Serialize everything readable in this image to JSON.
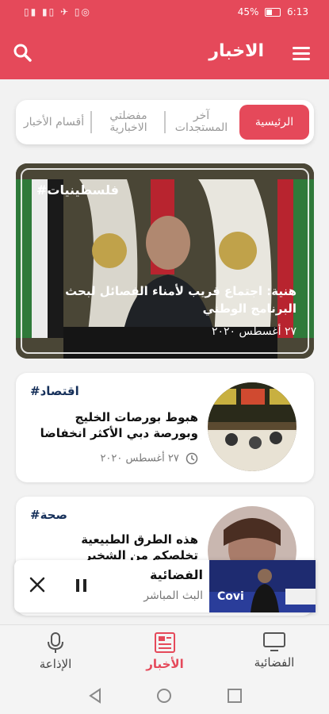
{
  "status_bar": {
    "signals": "▯▮ ▮▯ ✈ ▯◎",
    "battery": "45%",
    "time": "6:13"
  },
  "app_bar": {
    "title": "الاخبار",
    "menu_icon": "hamburger-icon",
    "search_icon": "search-icon"
  },
  "tabs": [
    {
      "label": "الرئيسية",
      "active": true
    },
    {
      "label": "آخر المستجدات",
      "active": false
    },
    {
      "label": "مفضلتي الاخبارية",
      "active": false
    },
    {
      "label": "أقسام الأخبار",
      "active": false
    }
  ],
  "featured": {
    "tag": "#فلسطينيات",
    "headline": "هنية: اجتماع قريب لأمناء الفصائل لبحث البرنامج الوطني",
    "date": "٢٧ أغسطس ٢٠٢٠"
  },
  "articles": [
    {
      "tag": "#اقتصاد",
      "headline": "هبوط بورصات الخليج وبورصة دبي الأكثر انخفاضا",
      "date": "٢٧ أغسطس ٢٠٢٠"
    },
    {
      "tag": "#صحة",
      "headline": "هذه الطرق الطبيعية تخلصكم من الشخير",
      "date": ""
    }
  ],
  "mini_player": {
    "title": "الفضائية",
    "subtitle": "البث المباشر",
    "close_icon": "close-icon",
    "pause_icon": "pause-icon",
    "thumb_text": "Covi"
  },
  "bottom_nav": [
    {
      "label": "الفضائية",
      "icon": "tv-icon",
      "active": false
    },
    {
      "label": "الأخبار",
      "icon": "newspaper-icon",
      "active": true
    },
    {
      "label": "الإذاعة",
      "icon": "microphone-icon",
      "active": false
    }
  ],
  "colors": {
    "accent": "#e5495a",
    "tag": "#16305a"
  }
}
